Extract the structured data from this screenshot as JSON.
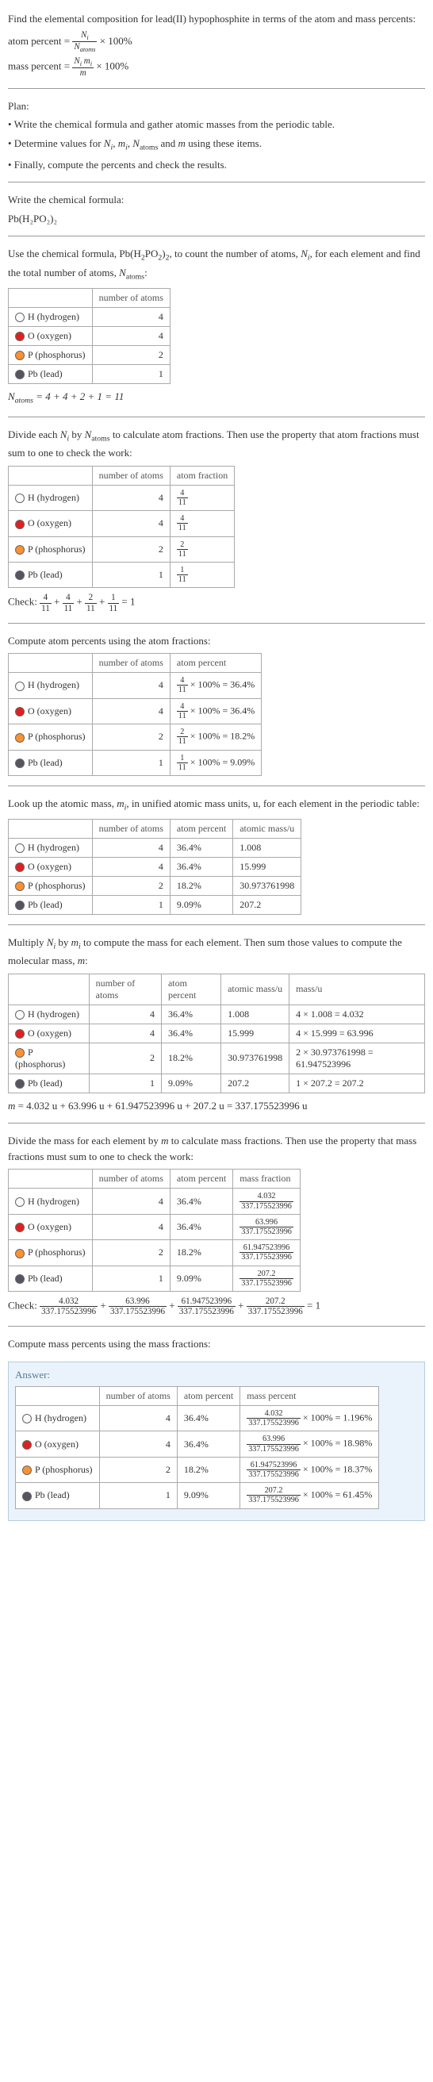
{
  "intro": {
    "line1": "Find the elemental composition for lead(II) hypophosphite in terms of the atom and mass percents:",
    "atom_percent_label": "atom percent =",
    "atom_percent_frac_num": "N_i",
    "atom_percent_frac_den": "N_atoms",
    "times100": "× 100%",
    "mass_percent_label": "mass percent =",
    "mass_percent_frac_num": "N_i m_i",
    "mass_percent_frac_den": "m"
  },
  "plan": {
    "heading": "Plan:",
    "bullet1": "• Write the chemical formula and gather atomic masses from the periodic table.",
    "bullet2": "• Determine values for N_i, m_i, N_atoms and m using these items.",
    "bullet3": "• Finally, compute the percents and check the results."
  },
  "formula": {
    "heading": "Write the chemical formula:",
    "value": "Pb(H₂PO₂)₂"
  },
  "count": {
    "text": "Use the chemical formula, Pb(H₂PO₂)₂, to count the number of atoms, N_i, for each element and find the total number of atoms, N_atoms:",
    "header_num": "number of atoms",
    "rows": [
      {
        "el": "H (hydrogen)",
        "color": "#fafafa",
        "n": "4"
      },
      {
        "el": "O (oxygen)",
        "color": "#e02020",
        "n": "4"
      },
      {
        "el": "P (phosphorus)",
        "color": "#ff9030",
        "n": "2"
      },
      {
        "el": "Pb (lead)",
        "color": "#555560",
        "n": "1"
      }
    ],
    "sum": "N_atoms = 4 + 4 + 2 + 1 = 11"
  },
  "atom_frac": {
    "text": "Divide each N_i by N_atoms to calculate atom fractions. Then use the property that atom fractions must sum to one to check the work:",
    "header_num": "number of atoms",
    "header_frac": "atom fraction",
    "rows": [
      {
        "el": "H (hydrogen)",
        "color": "#fafafa",
        "n": "4",
        "fn": "4",
        "fd": "11"
      },
      {
        "el": "O (oxygen)",
        "color": "#e02020",
        "n": "4",
        "fn": "4",
        "fd": "11"
      },
      {
        "el": "P (phosphorus)",
        "color": "#ff9030",
        "n": "2",
        "fn": "2",
        "fd": "11"
      },
      {
        "el": "Pb (lead)",
        "color": "#555560",
        "n": "1",
        "fn": "1",
        "fd": "11"
      }
    ],
    "check": "Check: 4/11 + 4/11 + 2/11 + 1/11 = 1"
  },
  "atom_pct": {
    "text": "Compute atom percents using the atom fractions:",
    "header_num": "number of atoms",
    "header_pct": "atom percent",
    "rows": [
      {
        "el": "H (hydrogen)",
        "color": "#fafafa",
        "n": "4",
        "fn": "4",
        "fd": "11",
        "pct": "× 100% = 36.4%"
      },
      {
        "el": "O (oxygen)",
        "color": "#e02020",
        "n": "4",
        "fn": "4",
        "fd": "11",
        "pct": "× 100% = 36.4%"
      },
      {
        "el": "P (phosphorus)",
        "color": "#ff9030",
        "n": "2",
        "fn": "2",
        "fd": "11",
        "pct": "× 100% = 18.2%"
      },
      {
        "el": "Pb (lead)",
        "color": "#555560",
        "n": "1",
        "fn": "1",
        "fd": "11",
        "pct": "× 100% = 9.09%"
      }
    ]
  },
  "atomic_mass": {
    "text": "Look up the atomic mass, m_i, in unified atomic mass units, u, for each element in the periodic table:",
    "header_num": "number of atoms",
    "header_pct": "atom percent",
    "header_mass": "atomic mass/u",
    "rows": [
      {
        "el": "H (hydrogen)",
        "color": "#fafafa",
        "n": "4",
        "pct": "36.4%",
        "m": "1.008"
      },
      {
        "el": "O (oxygen)",
        "color": "#e02020",
        "n": "4",
        "pct": "36.4%",
        "m": "15.999"
      },
      {
        "el": "P (phosphorus)",
        "color": "#ff9030",
        "n": "2",
        "pct": "18.2%",
        "m": "30.973761998"
      },
      {
        "el": "Pb (lead)",
        "color": "#555560",
        "n": "1",
        "pct": "9.09%",
        "m": "207.2"
      }
    ]
  },
  "mol_mass": {
    "text": "Multiply N_i by m_i to compute the mass for each element. Then sum those values to compute the molecular mass, m:",
    "header_num": "number of atoms",
    "header_pct": "atom percent",
    "header_mass": "atomic mass/u",
    "header_massu": "mass/u",
    "rows": [
      {
        "el": "H (hydrogen)",
        "color": "#fafafa",
        "n": "4",
        "pct": "36.4%",
        "m": "1.008",
        "mu": "4 × 1.008 = 4.032"
      },
      {
        "el": "O (oxygen)",
        "color": "#e02020",
        "n": "4",
        "pct": "36.4%",
        "m": "15.999",
        "mu": "4 × 15.999 = 63.996"
      },
      {
        "el": "P (phosphorus)",
        "color": "#ff9030",
        "n": "2",
        "pct": "18.2%",
        "m": "30.973761998",
        "mu": "2 × 30.973761998 = 61.947523996"
      },
      {
        "el": "Pb (lead)",
        "color": "#555560",
        "n": "1",
        "pct": "9.09%",
        "m": "207.2",
        "mu": "1 × 207.2 = 207.2"
      }
    ],
    "sum": "m = 4.032 u + 63.996 u + 61.947523996 u + 207.2 u = 337.175523996 u"
  },
  "mass_frac": {
    "text": "Divide the mass for each element by m to calculate mass fractions. Then use the property that mass fractions must sum to one to check the work:",
    "header_num": "number of atoms",
    "header_pct": "atom percent",
    "header_mf": "mass fraction",
    "rows": [
      {
        "el": "H (hydrogen)",
        "color": "#fafafa",
        "n": "4",
        "pct": "36.4%",
        "fn": "4.032",
        "fd": "337.175523996"
      },
      {
        "el": "O (oxygen)",
        "color": "#e02020",
        "n": "4",
        "pct": "36.4%",
        "fn": "63.996",
        "fd": "337.175523996"
      },
      {
        "el": "P (phosphorus)",
        "color": "#ff9030",
        "n": "2",
        "pct": "18.2%",
        "fn": "61.947523996",
        "fd": "337.175523996"
      },
      {
        "el": "Pb (lead)",
        "color": "#555560",
        "n": "1",
        "pct": "9.09%",
        "fn": "207.2",
        "fd": "337.175523996"
      }
    ],
    "check_label": "Check:",
    "check_parts": [
      {
        "n": "4.032",
        "d": "337.175523996"
      },
      {
        "n": "63.996",
        "d": "337.175523996"
      },
      {
        "n": "61.947523996",
        "d": "337.175523996"
      },
      {
        "n": "207.2",
        "d": "337.175523996"
      }
    ],
    "check_eq": "= 1"
  },
  "mass_pct": {
    "text": "Compute mass percents using the mass fractions:"
  },
  "answer": {
    "label": "Answer:",
    "header_num": "number of atoms",
    "header_pct": "atom percent",
    "header_mpct": "mass percent",
    "rows": [
      {
        "el": "H (hydrogen)",
        "color": "#fafafa",
        "n": "4",
        "pct": "36.4%",
        "fn": "4.032",
        "fd": "337.175523996",
        "res": "× 100% = 1.196%"
      },
      {
        "el": "O (oxygen)",
        "color": "#e02020",
        "n": "4",
        "pct": "36.4%",
        "fn": "63.996",
        "fd": "337.175523996",
        "res": "× 100% = 18.98%"
      },
      {
        "el": "P (phosphorus)",
        "color": "#ff9030",
        "n": "2",
        "pct": "18.2%",
        "fn": "61.947523996",
        "fd": "337.175523996",
        "res": "× 100% = 18.37%"
      },
      {
        "el": "Pb (lead)",
        "color": "#555560",
        "n": "1",
        "pct": "9.09%",
        "fn": "207.2",
        "fd": "337.175523996",
        "res": "× 100% = 61.45%"
      }
    ]
  }
}
